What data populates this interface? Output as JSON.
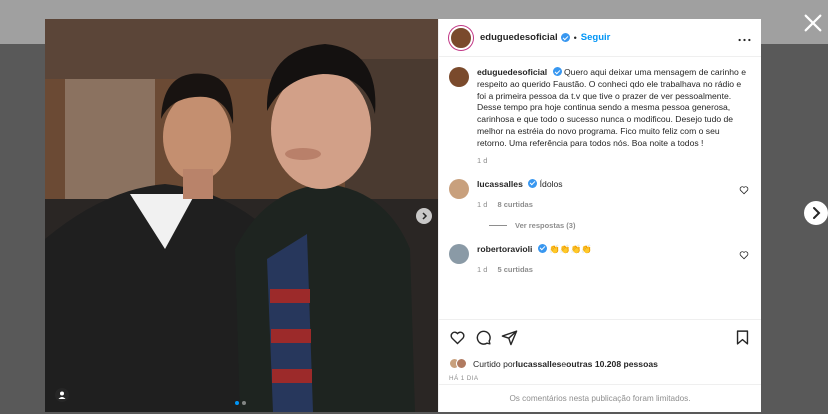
{
  "post": {
    "author": "eduguedesoficial",
    "follow_label": "Seguir",
    "separator": "•",
    "caption_text": "Quero aqui deixar uma mensagem de carinho e respeito ao querido Faustão. O conheci qdo ele trabalhava no rádio e foi a primeira pessoa da t.v que tive o prazer de ver pessoalmente. Desse tempo pra hoje continua sendo a mesma pessoa generosa, carinhosa e que todo o sucesso nunca o modificou. Desejo tudo de melhor na estréia do novo programa. Fico muito feliz com o seu retorno. Uma referência para todos nós. Boa noite a todos !",
    "caption_age": "1 d",
    "comments": [
      {
        "user": "lucassalles",
        "text": "Ídolos",
        "age": "1 d",
        "likes": "8 curtidas"
      },
      {
        "user": "robertoravioli",
        "text": "👏👏👏👏",
        "age": "1 d",
        "likes": "5 curtidas"
      }
    ],
    "view_replies": "Ver respostas (3)",
    "likes_prefix": "Curtido por ",
    "likes_user": "lucassalles",
    "likes_middle": " e ",
    "likes_others": "outras 10.208 pessoas",
    "timestamp": "HÁ 1 DIA",
    "comments_limited": "Os comentários nesta publicação foram limitados."
  },
  "colors": {
    "accent": "#0095f6",
    "verified": "#3897f0",
    "text": "#262626",
    "muted": "#8e8e8e"
  },
  "icons": [
    "close-icon",
    "next-arrow-icon",
    "more-options-icon",
    "verified-badge-icon",
    "heart-icon",
    "comment-icon",
    "share-icon",
    "bookmark-icon",
    "user-tag-icon"
  ]
}
